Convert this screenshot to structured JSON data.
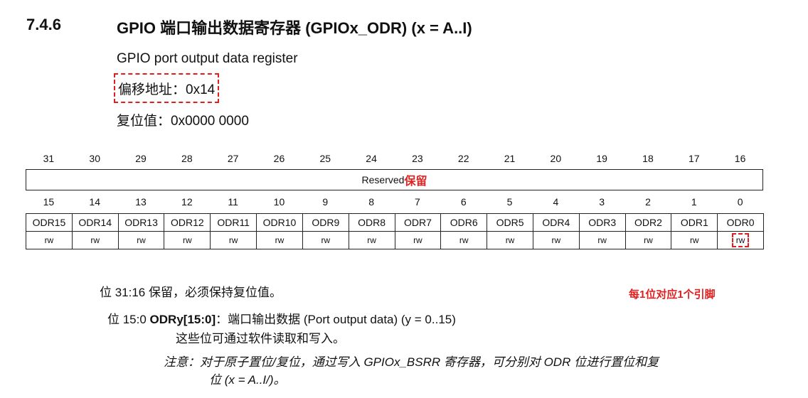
{
  "section": {
    "number": "7.4.6",
    "title": "GPIO 端口输出数据寄存器 (GPIOx_ODR) (x = A..I)",
    "subtitle": "GPIO port output data register",
    "offset": "偏移地址：0x14",
    "reset": "复位值：0x0000 0000"
  },
  "register": {
    "bits_high": [
      "31",
      "30",
      "29",
      "28",
      "27",
      "26",
      "25",
      "24",
      "23",
      "22",
      "21",
      "20",
      "19",
      "18",
      "17",
      "16"
    ],
    "reserved_label": "Reserved",
    "reserved_cn": "保留",
    "bits_low": [
      "15",
      "14",
      "13",
      "12",
      "11",
      "10",
      "9",
      "8",
      "7",
      "6",
      "5",
      "4",
      "3",
      "2",
      "1",
      "0"
    ],
    "fields": [
      "ODR15",
      "ODR14",
      "ODR13",
      "ODR12",
      "ODR11",
      "ODR10",
      "ODR9",
      "ODR8",
      "ODR7",
      "ODR6",
      "ODR5",
      "ODR4",
      "ODR3",
      "ODR2",
      "ODR1",
      "ODR0"
    ],
    "access": [
      "rw",
      "rw",
      "rw",
      "rw",
      "rw",
      "rw",
      "rw",
      "rw",
      "rw",
      "rw",
      "rw",
      "rw",
      "rw",
      "rw",
      "rw",
      "rw"
    ]
  },
  "description": {
    "bits_31_16": "位 31:16  保留，必须保持复位值。",
    "annotation": "每1位对应1个引脚",
    "bits_15_0_prefix": "位 15:0  ",
    "bits_15_0_name": "ODRy[15:0]",
    "bits_15_0_text": "：端口输出数据 (Port output data) (y = 0..15)",
    "bits_15_0_detail": "这些位可通过软件读取和写入。",
    "note_line1": "注意：对于原子置位/复位，通过写入 GPIOx_BSRR 寄存器，可分别对 ODR 位进行置位和复",
    "note_line2": "位 (x = A..I/)。"
  }
}
